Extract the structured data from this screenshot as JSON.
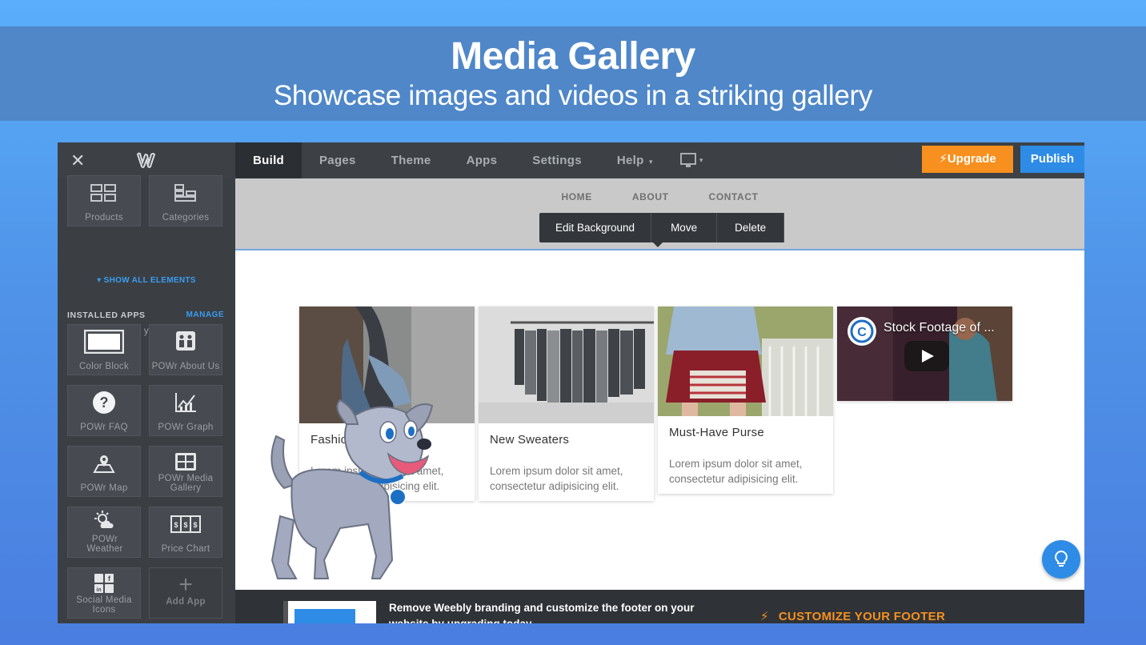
{
  "banner": {
    "title": "Media Gallery",
    "subtitle": "Showcase images and videos in a striking gallery"
  },
  "topbar": {
    "close": "✕",
    "tabs": [
      "Build",
      "Pages",
      "Theme",
      "Apps",
      "Settings",
      "Help"
    ],
    "upgrade_label": "Upgrade",
    "publish_label": "Publish"
  },
  "sidebar": {
    "elements": [
      "Products",
      "Categories"
    ],
    "show_all": "SHOW ALL ELEMENTS",
    "installed_title": "INSTALLED APPS",
    "manage": "MANAGE",
    "installed_desc": "Add apps to make your site more powerful.",
    "apps": [
      "Color Block",
      "POWr About Us",
      "POWr FAQ",
      "POWr Graph",
      "POWr Map",
      "POWr Media Gallery",
      "POWr Weather",
      "Price Chart",
      "Social Media Icons",
      "Add App"
    ]
  },
  "site": {
    "nav": [
      "HOME",
      "ABOUT",
      "CONTACT"
    ],
    "toolbar": [
      "Edit Background",
      "Move",
      "Delete"
    ]
  },
  "gallery": {
    "cards": [
      {
        "title": "Fashion",
        "desc": "Lorem ipsum dolor sit amet, consectetur adipisicing elit."
      },
      {
        "title": "New Sweaters",
        "desc": "Lorem ipsum dolor sit amet, consectetur adipisicing elit."
      },
      {
        "title": "Must-Have Purse",
        "desc": "Lorem ipsum dolor sit amet, consectetur adipisicing elit."
      }
    ],
    "video_title": "Stock Footage of ..."
  },
  "footer": {
    "text": "Remove Weebly branding and customize the footer on your website by upgrading today.",
    "cta": "CUSTOMIZE YOUR FOOTER"
  },
  "colors": {
    "upgrade": "#f7901e",
    "publish": "#2e8ce6",
    "accent_link": "#3b9cf0"
  }
}
